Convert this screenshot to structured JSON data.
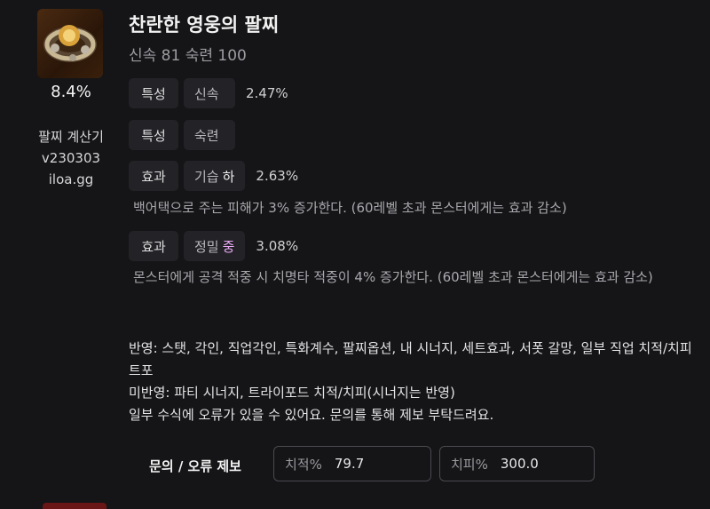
{
  "item": {
    "title": "찬란한 영웅의 팔찌",
    "subtitle": "신속 81   숙련 100",
    "percent": "8.4%",
    "icon": "bracelet-icon"
  },
  "calculator": {
    "line1": "팔찌 계산기",
    "line2": "v230303",
    "line3": "iloa.gg"
  },
  "effects": [
    {
      "type": "특성",
      "name": "신속",
      "grade": "",
      "value": "2.47%"
    },
    {
      "type": "특성",
      "name": "숙련",
      "grade": "",
      "value": ""
    },
    {
      "type": "효과",
      "name": "기습",
      "grade": "하",
      "value": "2.63%",
      "description": "백어택으로 주는 피해가 3% 증가한다. (60레벨 초과 몬스터에게는 효과 감소)"
    },
    {
      "type": "효과",
      "name": "정밀",
      "grade": "중",
      "value": "3.08%",
      "description": "몬스터에게 공격 적중 시 치명타 적중이 4% 증가한다. (60레벨 초과 몬스터에게는 효과 감소)"
    }
  ],
  "notes": {
    "applied": "반영: 스탯, 각인, 직업각인, 특화계수, 팔찌옵션, 내 시너지, 세트효과, 서폿 갈망, 일부 직업 치적/치피 트포",
    "not_applied": "미반영: 파티 시너지, 트라이포드 치적/치피(시너지는 반영)",
    "disclaimer": "일부 수식에 오류가 있을 수 있어요. 문의를 통해 제보 부탁드려요."
  },
  "footer": {
    "report_label": "문의 / 오류 제보",
    "crit_rate_label": "치적%",
    "crit_rate_value": "79.7",
    "crit_dmg_label": "치피%",
    "crit_dmg_value": "300.0"
  }
}
